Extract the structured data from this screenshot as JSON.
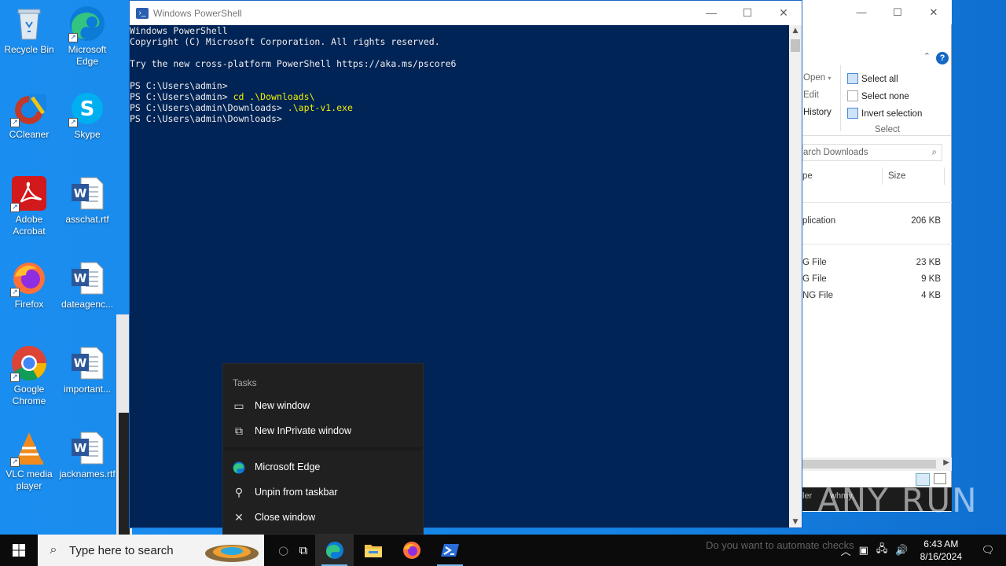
{
  "desktop": {
    "icons": [
      {
        "label": "Recycle Bin"
      },
      {
        "label": "Microsoft Edge"
      },
      {
        "label": "CCleaner"
      },
      {
        "label": "Skype"
      },
      {
        "label": "Adobe Acrobat"
      },
      {
        "label": "asschat.rtf"
      },
      {
        "label": "Firefox"
      },
      {
        "label": "dateagenc..."
      },
      {
        "label": "Google Chrome"
      },
      {
        "label": "important..."
      },
      {
        "label": "VLC media player"
      },
      {
        "label": "jacknames.rtf"
      }
    ]
  },
  "powershell": {
    "title": "Windows PowerShell",
    "lines": {
      "l1": "Windows PowerShell",
      "l2": "Copyright (C) Microsoft Corporation. All rights reserved.",
      "l3": "Try the new cross-platform PowerShell https://aka.ms/pscore6",
      "p1": "PS C:\\Users\\admin>",
      "p2": "PS C:\\Users\\admin> ",
      "c2": "cd .\\Downloads\\",
      "p3": "PS C:\\Users\\admin\\Downloads> ",
      "c3": ".\\apt-v1.exe",
      "p4": "PS C:\\Users\\admin\\Downloads>"
    }
  },
  "explorer": {
    "ribbon": {
      "open": "Open",
      "edit": "Edit",
      "history": "History",
      "select_all": "Select all",
      "select_none": "Select none",
      "invert_selection": "Invert selection",
      "group_select": "Select"
    },
    "search_placeholder": "arch Downloads",
    "columns": {
      "type": "pe",
      "size": "Size"
    },
    "rows": [
      {
        "type": "plication",
        "size": "206 KB"
      },
      {
        "type": "G File",
        "size": "23 KB"
      },
      {
        "type": "G File",
        "size": "9 KB"
      },
      {
        "type": "NG File",
        "size": "4 KB"
      }
    ],
    "status_fragment": "ler",
    "status_fragment2": "whmy."
  },
  "jumplist": {
    "section": "Tasks",
    "items": [
      {
        "label": "New window",
        "icon": "window-icon"
      },
      {
        "label": "New InPrivate window",
        "icon": "inprivate-icon"
      },
      {
        "label": "Microsoft Edge",
        "icon": "edge-icon"
      },
      {
        "label": "Unpin from taskbar",
        "icon": "unpin-icon"
      },
      {
        "label": "Close window",
        "icon": "close-icon"
      }
    ]
  },
  "taskbar": {
    "search_placeholder": "Type here to search",
    "time": "6:43 AM",
    "date": "8/16/2024",
    "ghost_text": "Do you want to automate checks"
  },
  "watermark": "ANY RUN",
  "colors": {
    "console_bg": "#012456",
    "command": "#f0f000",
    "desktop": "#1584e4"
  }
}
